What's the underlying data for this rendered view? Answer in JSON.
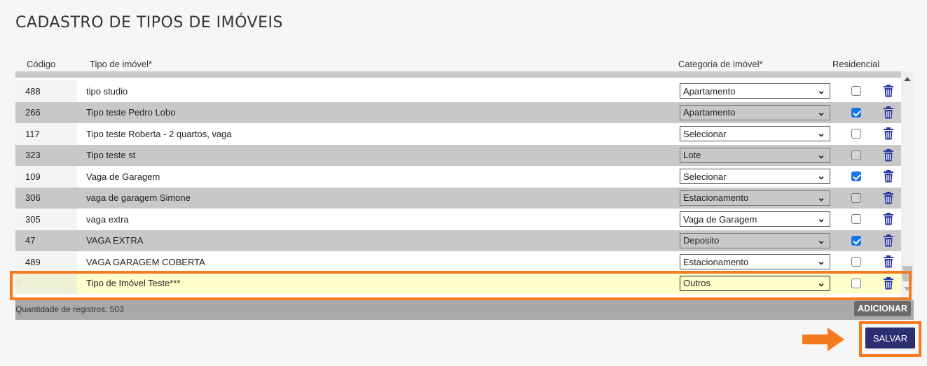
{
  "page": {
    "title": "CADASTRO DE TIPOS DE IMÓVEIS"
  },
  "columns": {
    "code": "Código",
    "type": "Tipo de imóvel*",
    "category": "Categoria de imóvel*",
    "residential": "Residencial"
  },
  "rows": [
    {
      "code": "488",
      "type": "tipo studio",
      "category": "Apartamento",
      "residential": false
    },
    {
      "code": "266",
      "type": "Tipo teste Pedro Lobo",
      "category": "Apartamento",
      "residential": true
    },
    {
      "code": "117",
      "type": "Tipo teste Roberta - 2 quartos, vaga",
      "category": "Selecionar",
      "residential": false
    },
    {
      "code": "323",
      "type": "Tipo teste st",
      "category": "Lote",
      "residential": false
    },
    {
      "code": "109",
      "type": "Vaga de Garagem",
      "category": "Selecionar",
      "residential": true
    },
    {
      "code": "306",
      "type": "vaga de garagem Simone",
      "category": "Estacionamento",
      "residential": false
    },
    {
      "code": "305",
      "type": "vaga extra",
      "category": "Vaga de Garagem",
      "residential": false
    },
    {
      "code": "47",
      "type": "VAGA EXTRA",
      "category": "Deposito",
      "residential": true
    },
    {
      "code": "489",
      "type": "VAGA GARAGEM COBERTA",
      "category": "Estacionamento",
      "residential": false
    }
  ],
  "new_row": {
    "code": "",
    "type": "Tipo de Imóvel  Teste***",
    "category": "Outros",
    "residential": false
  },
  "footer": {
    "count_label": "Quantidade de registros: 503",
    "add_label": "ADICIONAR"
  },
  "actions": {
    "save_label": "SALVAR"
  },
  "colors": {
    "highlight": "#f47a20",
    "save": "#2b2f72",
    "checkbox_on": "#1a73e8",
    "row_alt": "#c8c8c8",
    "new_row": "#ffffcc"
  }
}
